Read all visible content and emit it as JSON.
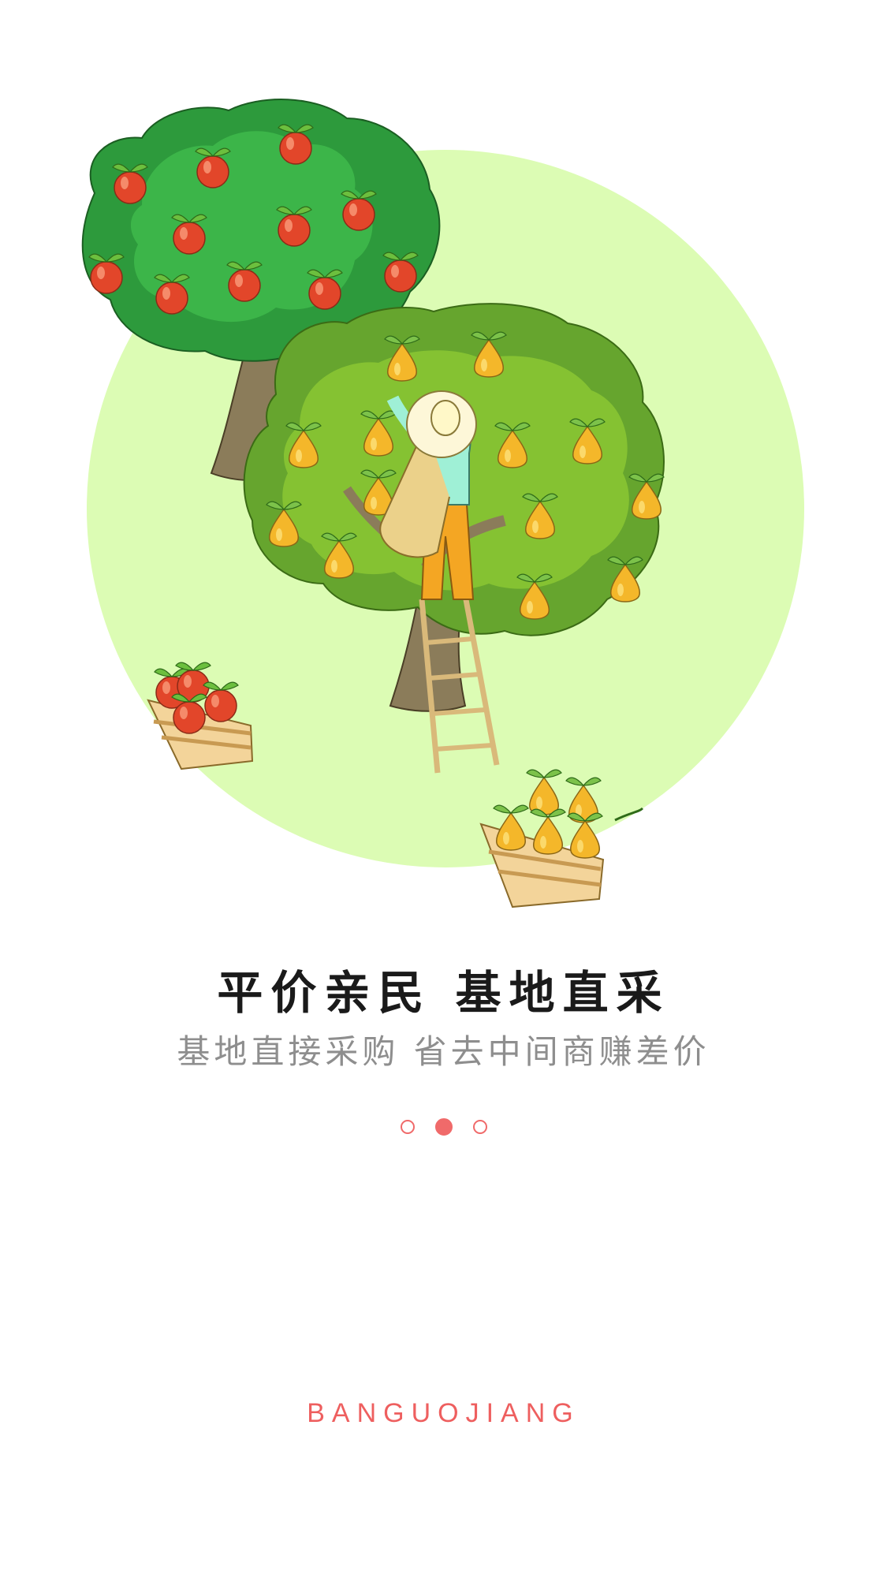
{
  "onboarding": {
    "title": "平价亲民 基地直采",
    "subtitle": "基地直接采购 省去中间商赚差价",
    "page_indicator": {
      "total": 3,
      "active_index": 1
    },
    "brand": "BANGUOJIANG"
  },
  "illustration": {
    "name": "orchard-harvest-illustration",
    "elements": [
      "apple-tree-icon",
      "pear-tree-icon",
      "farmer-on-ladder-icon",
      "apple-crate-icon",
      "pear-crate-icon"
    ]
  },
  "colors": {
    "accent": "#f06a6a",
    "circle_background": "#dcfcb4",
    "title": "#1a1a1a",
    "subtitle": "#8e8e8e"
  }
}
